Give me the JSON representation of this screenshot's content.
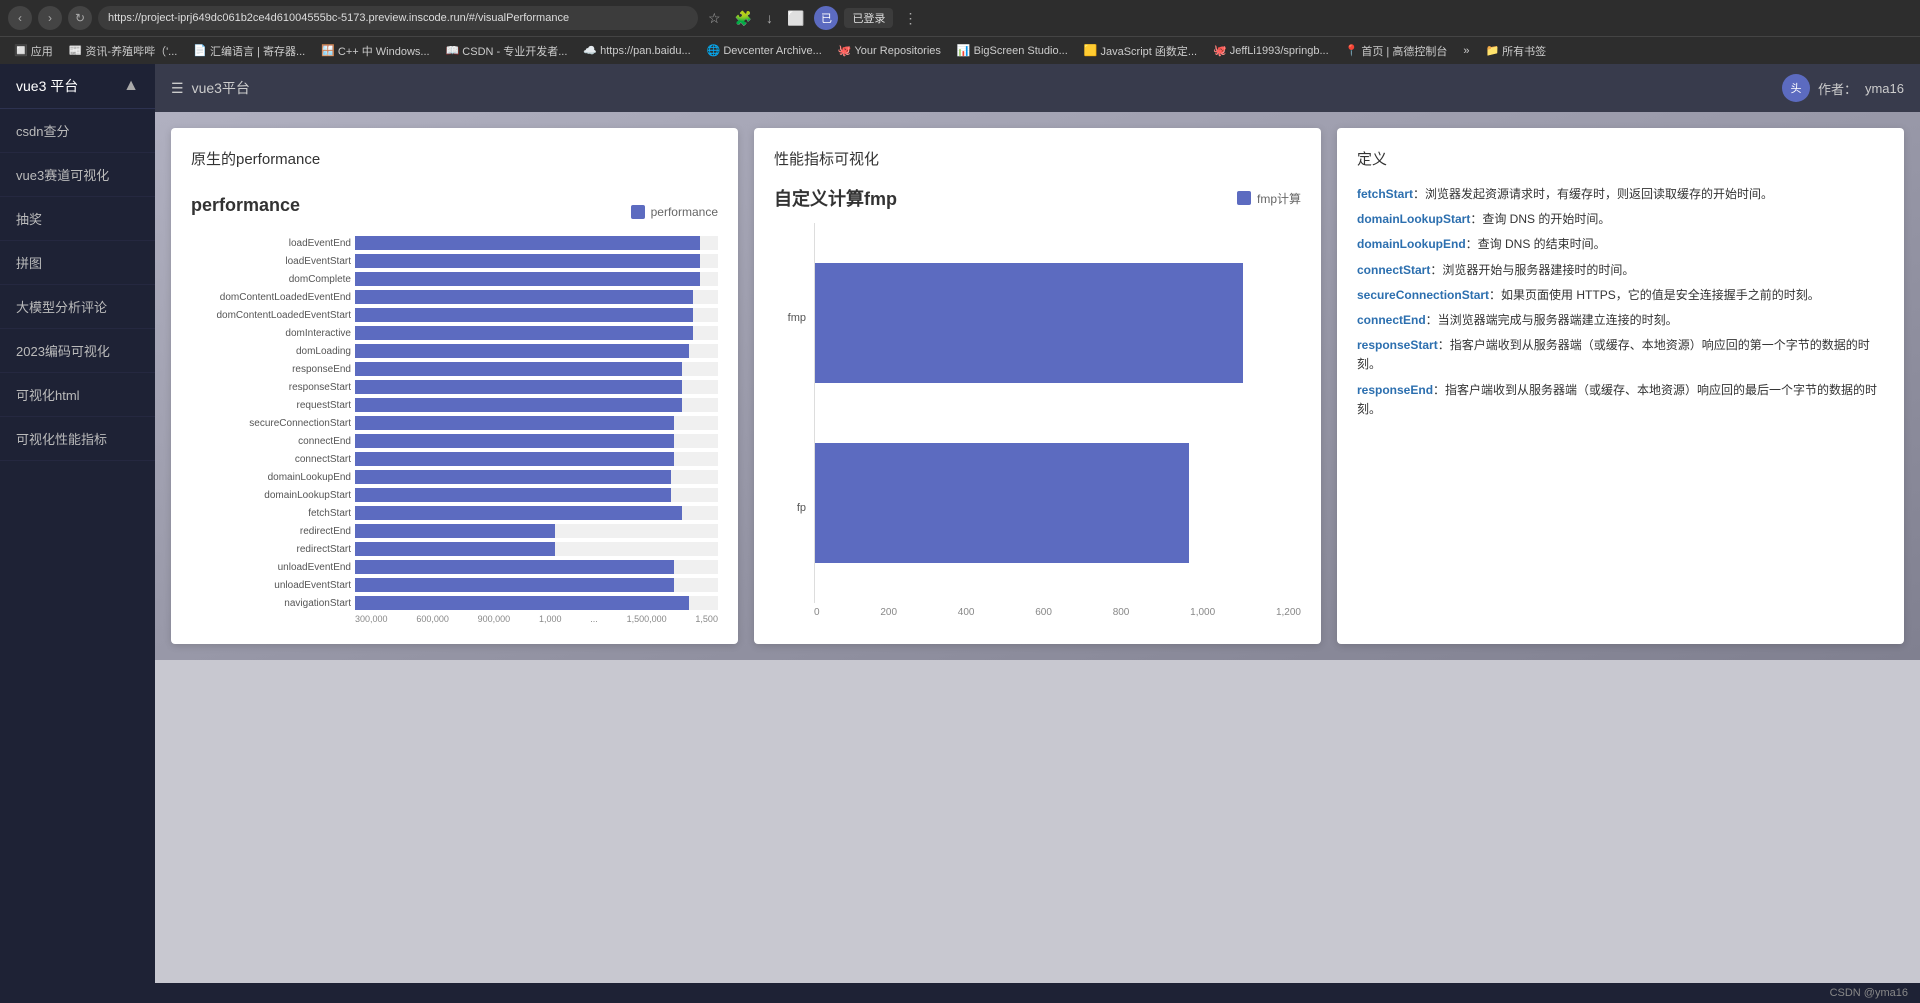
{
  "browser": {
    "url": "https://project-iprj649dc061b2ce4d61004555bc-5173.preview.inscode.run/#/visualPerformance",
    "profile": "已登录",
    "bookmarks": [
      {
        "label": "应用",
        "icon": "🔲"
      },
      {
        "label": "资讯-养殖哔哔（'...",
        "icon": "📰"
      },
      {
        "label": "汇编语言 | 寄存器...",
        "icon": "📄"
      },
      {
        "label": "C++ 中 Windows...",
        "icon": "🪟"
      },
      {
        "label": "CSDN - 专业开发者...",
        "icon": "📖"
      },
      {
        "label": "https://pan.baidu...",
        "icon": "☁️"
      },
      {
        "label": "Devcenter Archive...",
        "icon": "🌐"
      },
      {
        "label": "Your Repositories",
        "icon": "🐙"
      },
      {
        "label": "BigScreen Studio...",
        "icon": "📊"
      },
      {
        "label": "JavaScript 函数定...",
        "icon": "🟨"
      },
      {
        "label": "JeffLi1993/springb...",
        "icon": "🐙"
      },
      {
        "label": "首页 | 高德控制台",
        "icon": "📍"
      },
      {
        "label": "»",
        "icon": ""
      },
      {
        "label": "所有书签",
        "icon": "📁"
      }
    ]
  },
  "sidebar": {
    "title": "vue3 平台",
    "items": [
      {
        "label": "csdn查分"
      },
      {
        "label": "vue3赛道可视化"
      },
      {
        "label": "抽奖"
      },
      {
        "label": "拼图"
      },
      {
        "label": "大模型分析评论"
      },
      {
        "label": "2023编码可视化"
      },
      {
        "label": "可视化html"
      },
      {
        "label": "可视化性能指标"
      }
    ]
  },
  "topbar": {
    "breadcrumb_icon": "☰",
    "breadcrumb_text": "vue3平台",
    "author_label": "作者：",
    "author_name": "yma16"
  },
  "panel1": {
    "title": "原生的performance",
    "chart_title": "performance",
    "legend_label": "performance",
    "bars": [
      {
        "label": "loadEventEnd",
        "pct": 95
      },
      {
        "label": "loadEventStart",
        "pct": 95
      },
      {
        "label": "domComplete",
        "pct": 95
      },
      {
        "label": "domContentLoadedEventEnd",
        "pct": 93
      },
      {
        "label": "domContentLoadedEventStart",
        "pct": 93
      },
      {
        "label": "domInteractive",
        "pct": 93
      },
      {
        "label": "domLoading",
        "pct": 92
      },
      {
        "label": "responseEnd",
        "pct": 90
      },
      {
        "label": "responseStart",
        "pct": 90
      },
      {
        "label": "requestStart",
        "pct": 90
      },
      {
        "label": "secureConnectionStart",
        "pct": 88
      },
      {
        "label": "connectEnd",
        "pct": 88
      },
      {
        "label": "connectStart",
        "pct": 88
      },
      {
        "label": "domainLookupEnd",
        "pct": 87
      },
      {
        "label": "domainLookupStart",
        "pct": 87
      },
      {
        "label": "fetchStart",
        "pct": 90
      },
      {
        "label": "redirectEnd",
        "pct": 55
      },
      {
        "label": "redirectStart",
        "pct": 55
      },
      {
        "label": "unloadEventEnd",
        "pct": 88
      },
      {
        "label": "unloadEventStart",
        "pct": 88
      },
      {
        "label": "navigationStart",
        "pct": 92
      }
    ],
    "xaxis": [
      "300,000",
      "600,000",
      "900,000",
      "1,000",
      "...",
      "1,500,000",
      "1,500"
    ]
  },
  "panel2": {
    "title": "性能指标可视化",
    "chart_title": "自定义计算fmp",
    "legend_label": "fmp计算",
    "bars": [
      {
        "label": "fmp",
        "value": 1050,
        "pct": 88
      },
      {
        "label": "fp",
        "value": 920,
        "pct": 77
      }
    ],
    "xaxis": [
      "0",
      "200",
      "400",
      "600",
      "800",
      "1,000",
      "1,200"
    ]
  },
  "panel3": {
    "title": "定义",
    "definitions": [
      {
        "term": "fetchStart",
        "desc": "：浏览器发起资源请求时，有缓存时，则返回读取缓存的开始时间。"
      },
      {
        "term": "domainLookupStart",
        "desc": "：查询 DNS 的开始时间。"
      },
      {
        "term": "domainLookupEnd",
        "desc": "：查询 DNS 的结束时间。"
      },
      {
        "term": "connectStart",
        "desc": "：浏览器开始与服务器建接时的时间。"
      },
      {
        "term": "secureConnectionStart",
        "desc": "：如果页面使用 HTTPS，它的值是安全连接握手之前的时刻。"
      },
      {
        "term": "connectEnd",
        "desc": "：当浏览器端完成与服务器端建立连接的时刻。"
      },
      {
        "term": "responseStart",
        "desc": "：指客户端收到从服务器端（或缓存、本地资源）响应回的第一个字节的数据的时刻。"
      },
      {
        "term": "responseEnd",
        "desc": "：指客户端收到从服务器端（或缓存、本地资源）响应回的最后一个字节的数据的时刻。"
      }
    ]
  },
  "statusbar": {
    "text": "CSDN @yma16"
  }
}
